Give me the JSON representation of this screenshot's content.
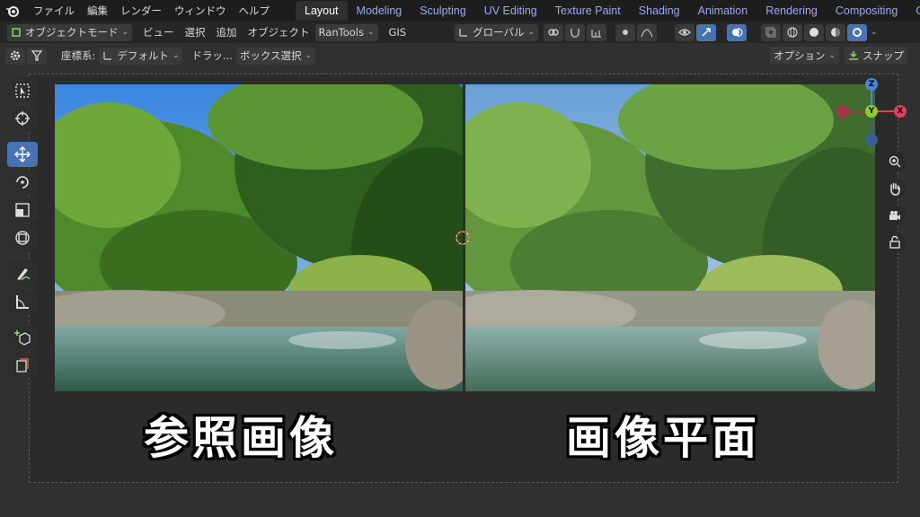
{
  "menubar": {
    "items": [
      "ファイル",
      "編集",
      "レンダー",
      "ウィンドウ",
      "ヘルプ"
    ]
  },
  "workspaces": [
    "Layout",
    "Modeling",
    "Sculpting",
    "UV Editing",
    "Texture Paint",
    "Shading",
    "Animation",
    "Rendering",
    "Compositing",
    "Geomet"
  ],
  "header": {
    "mode": "オブジェクトモード",
    "menus": [
      "ビュー",
      "選択",
      "追加",
      "オブジェクト"
    ],
    "addon": "RanTools",
    "gis": "GIS",
    "transform_orientation": "グローバル"
  },
  "subheader": {
    "coord_label": "座標系:",
    "coord_value": "デフォルト",
    "drag_label": "ドラッ...",
    "drag_value": "ボックス選択",
    "options": "オプション",
    "snap": "スナップ"
  },
  "gizmo": {
    "z": "Z",
    "y": "Y",
    "x": "X"
  },
  "captions": {
    "left": "参照画像",
    "right": "画像平面"
  },
  "colors": {
    "accent": "#4772b3",
    "workspace_text": "#9aa8ff",
    "axis_x": "#e0405a",
    "axis_y": "#8ccf2a",
    "axis_z": "#4a86d8"
  }
}
